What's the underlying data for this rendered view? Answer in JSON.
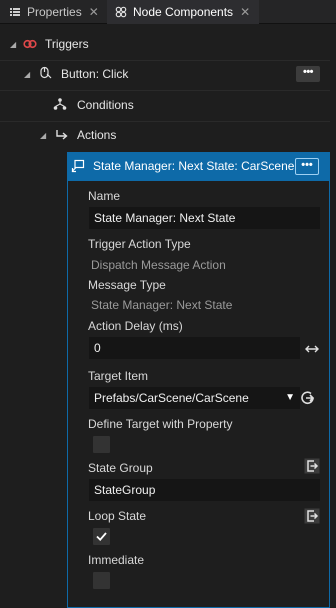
{
  "tabs": [
    {
      "label": "Properties",
      "icon": "list-icon",
      "active": false
    },
    {
      "label": "Node Components",
      "icon": "node-components-icon",
      "active": true
    }
  ],
  "tab_close_glyph": "✕",
  "tree": {
    "triggers_label": "Triggers",
    "button_click_label": "Button: Click",
    "conditions_label": "Conditions",
    "actions_label": "Actions",
    "selected_label": "State Manager: Next State: CarScene",
    "more_glyph": "•••"
  },
  "properties": {
    "name_label": "Name",
    "name_value": "State Manager: Next State",
    "trigger_action_type_label": "Trigger Action Type",
    "trigger_action_type_value": "Dispatch Message Action",
    "message_type_label": "Message Type",
    "message_type_value": "State Manager: Next State",
    "action_delay_label": "Action Delay (ms)",
    "action_delay_value": "0",
    "target_item_label": "Target Item",
    "target_item_value": "Prefabs/CarScene/CarScene",
    "define_target_label": "Define Target with Property",
    "define_target_checked": false,
    "state_group_label": "State Group",
    "state_group_value": "StateGroup",
    "loop_state_label": "Loop State",
    "loop_state_checked": true,
    "immediate_label": "Immediate",
    "immediate_checked": false
  },
  "colors": {
    "accent": "#0e6aa8",
    "trigger_icon": "#e0484a"
  }
}
